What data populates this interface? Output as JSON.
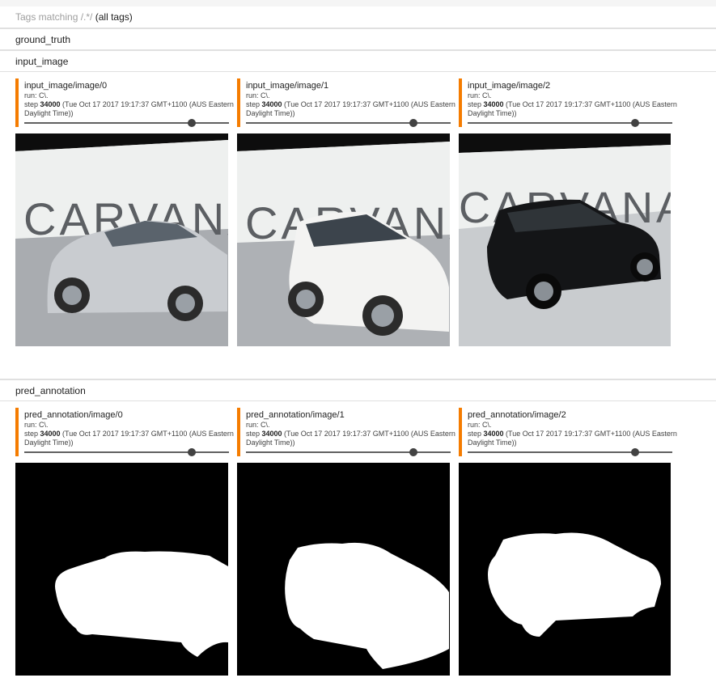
{
  "tags_header": {
    "prefix": "Tags matching ",
    "regex": "/.*/",
    "suffix": "(all tags)"
  },
  "sections": [
    {
      "title": "ground_truth"
    },
    {
      "title": "input_image"
    },
    {
      "title": "pred_annotation"
    }
  ],
  "input_cards": [
    {
      "title": "input_image/image/0",
      "run": "run: C\\.",
      "step_label": "step ",
      "step": "34000",
      "time": " (Tue Oct 17 2017 19:17:37 GMT+1100 (AUS Eastern",
      "time2": "Daylight Time))",
      "slider_fraction": 0.82,
      "image_icon": "white-sedan-photo",
      "brand_text": "CARVANA"
    },
    {
      "title": "input_image/image/1",
      "run": "run: C\\.",
      "step_label": "step ",
      "step": "34000",
      "time": " (Tue Oct 17 2017 19:17:37 GMT+1100 (AUS Eastern",
      "time2": "Daylight Time))",
      "slider_fraction": 0.82,
      "image_icon": "white-suv-photo",
      "brand_text": "CARVANA"
    },
    {
      "title": "input_image/image/2",
      "run": "run: C\\.",
      "step_label": "step ",
      "step": "34000",
      "time": " (Tue Oct 17 2017 19:17:37 GMT+1100 (AUS Eastern",
      "time2": "Daylight Time))",
      "slider_fraction": 0.82,
      "image_icon": "black-suv-photo",
      "brand_text": "CARVANA"
    }
  ],
  "pred_cards": [
    {
      "title": "pred_annotation/image/0",
      "run": "run: C\\.",
      "step_label": "step ",
      "step": "34000",
      "time": " (Tue Oct 17 2017 19:17:37 GMT+1100 (AUS Eastern",
      "time2": "Daylight Time))",
      "slider_fraction": 0.82,
      "image_icon": "sedan-mask"
    },
    {
      "title": "pred_annotation/image/1",
      "run": "run: C\\.",
      "step_label": "step ",
      "step": "34000",
      "time": " (Tue Oct 17 2017 19:17:37 GMT+1100 (AUS Eastern",
      "time2": "Daylight Time))",
      "slider_fraction": 0.82,
      "image_icon": "suv-mask"
    },
    {
      "title": "pred_annotation/image/2",
      "run": "run: C\\.",
      "step_label": "step ",
      "step": "34000",
      "time": " (Tue Oct 17 2017 19:17:37 GMT+1100 (AUS Eastern",
      "time2": "Daylight Time))",
      "slider_fraction": 0.82,
      "image_icon": "suv-mask"
    }
  ],
  "colors": {
    "accent": "#f57c00",
    "mask_bg": "#000000",
    "mask_fg": "#ffffff"
  }
}
